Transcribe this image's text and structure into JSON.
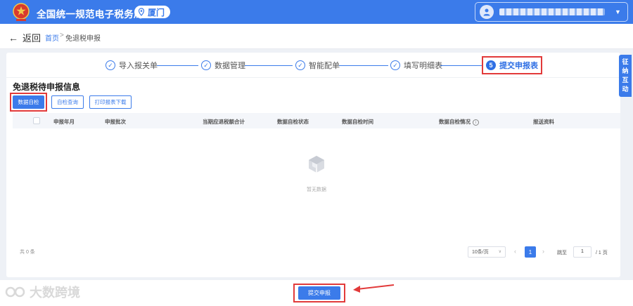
{
  "header": {
    "title": "全国统一规范电子税务局",
    "city": "厦门",
    "user_name": "██████████",
    "colors": {
      "primary": "#3b7bea",
      "highlight": "#e23a3a"
    },
    "icons": [
      "tax-emblem-icon",
      "location-pin-icon",
      "user-avatar-icon",
      "caret-down-icon"
    ]
  },
  "nav": {
    "back_label": "返回",
    "breadcrumb": {
      "home": "首页",
      "separator": ">",
      "current": "免退税申报"
    }
  },
  "steps": [
    {
      "label": "导入报关单",
      "state": "done"
    },
    {
      "label": "数据管理",
      "state": "done"
    },
    {
      "label": "智能配单",
      "state": "done"
    },
    {
      "label": "填写明细表",
      "state": "done"
    },
    {
      "label": "提交申报表",
      "number": "5",
      "state": "active"
    }
  ],
  "section": {
    "title": "免退税待申报信息",
    "buttons": {
      "data_check": "数据自检",
      "check_query": "自检查询",
      "print_download": "打印报表下载"
    }
  },
  "table": {
    "columns": [
      "申报年月",
      "申报批次",
      "当期应退税额合计",
      "数据自检状态",
      "数据自检时间",
      "数据自检情况",
      "报送资料"
    ],
    "rows": [],
    "empty_text": "暂无数据"
  },
  "pagination": {
    "total": "共 0 条",
    "page_size": "10条/页",
    "current_page": "1",
    "jump_label": "跳至",
    "jump_value": "1",
    "total_pages": "/ 1 页"
  },
  "side_float": {
    "label": "征纳互动"
  },
  "footer": {
    "submit_label": "提交申报",
    "watermark": "大数跨境"
  }
}
